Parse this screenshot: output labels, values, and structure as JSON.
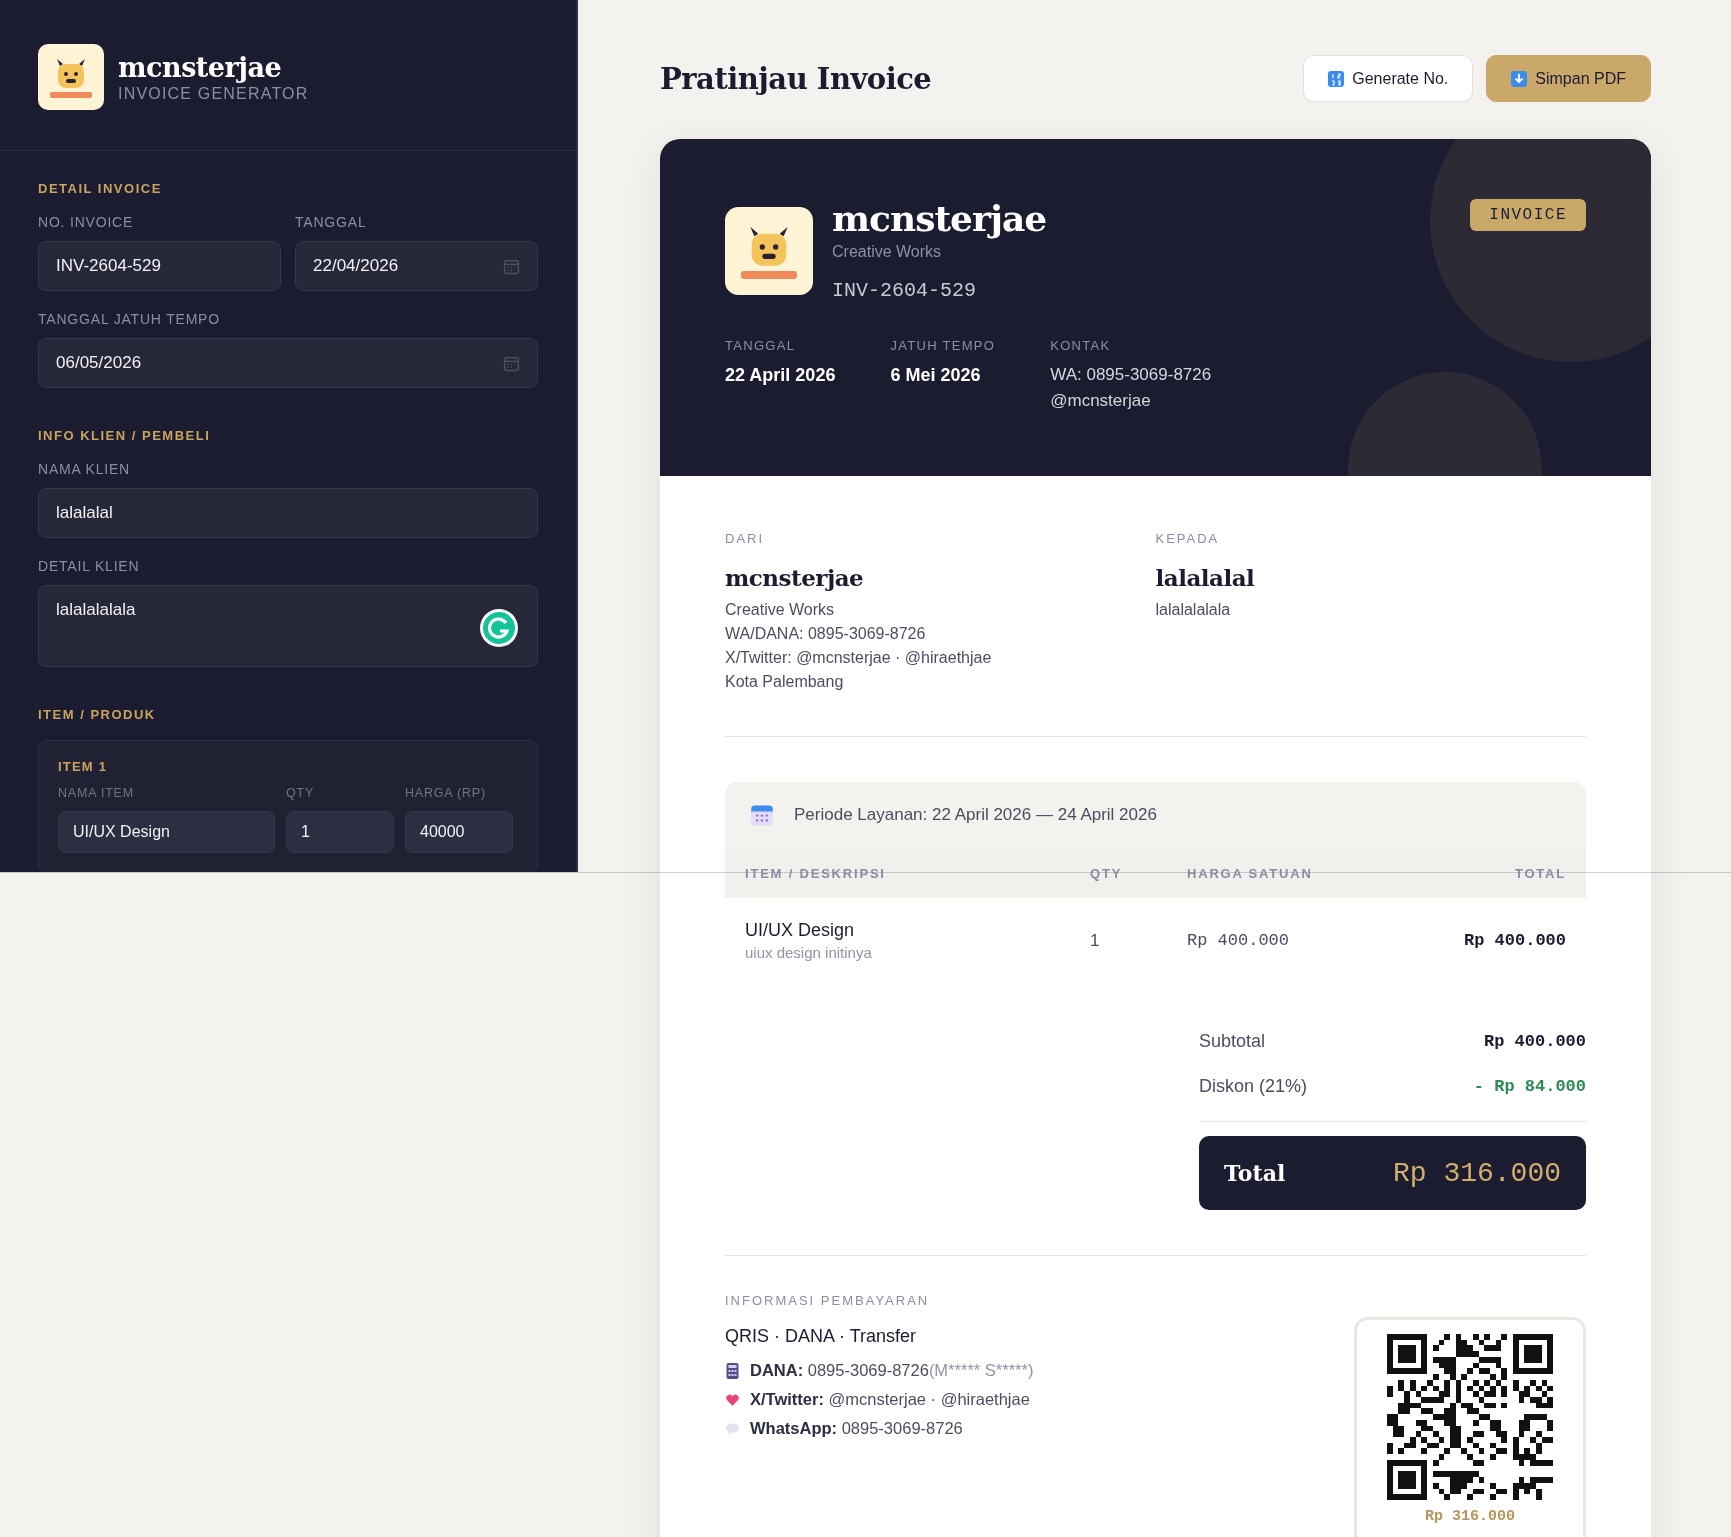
{
  "sidebar": {
    "brand": {
      "name": "mcnsterjae",
      "subtitle": "INVOICE GENERATOR"
    },
    "sections": [
      {
        "heading": "DETAIL INVOICE",
        "rows": [
          [
            {
              "label": "NO. INVOICE",
              "value": "INV-2604-529",
              "kind": "text"
            },
            {
              "label": "TANGGAL",
              "value": "22/04/2026",
              "kind": "date"
            }
          ],
          [
            {
              "label": "TANGGAL JATUH TEMPO",
              "value": "06/05/2026",
              "kind": "date"
            }
          ]
        ]
      },
      {
        "heading": "INFO KLIEN / PEMBELI",
        "rows": [
          [
            {
              "label": "NAMA KLIEN",
              "value": "lalalalal",
              "kind": "text"
            }
          ],
          [
            {
              "label": "DETAIL KLIEN",
              "value": "lalalalalala",
              "kind": "textarea"
            }
          ]
        ]
      }
    ],
    "items_section": {
      "heading": "ITEM / PRODUK",
      "items": [
        {
          "title": "ITEM 1",
          "fields": [
            {
              "label": "NAMA ITEM",
              "value": "UI/UX Design"
            },
            {
              "label": "QTY",
              "value": "1"
            },
            {
              "label": "HARGA (RP)",
              "value": "40000"
            }
          ]
        }
      ]
    }
  },
  "main": {
    "title": "Pratinjau Invoice",
    "buttons": [
      {
        "label": "Generate No.",
        "kind": "secondary"
      },
      {
        "label": "Simpan PDF",
        "kind": "primary"
      }
    ],
    "invoice": {
      "header": {
        "name": "mcnsterjae",
        "tagline": "Creative Works",
        "number": "INV-2604-529",
        "badge": "INVOICE",
        "meta": [
          {
            "label": "TANGGAL",
            "lines": [
              "22 April 2026"
            ],
            "kind": "strong"
          },
          {
            "label": "JATUH TEMPO",
            "lines": [
              "6 Mei 2026"
            ],
            "kind": "strong"
          },
          {
            "label": "KONTAK",
            "lines": [
              "WA: 0895-3069-8726",
              "@mcnsterjae"
            ],
            "kind": "plain"
          }
        ]
      },
      "parties": [
        {
          "label": "DARI",
          "name": "mcnsterjae",
          "lines": [
            "Creative Works",
            "WA/DANA: 0895-3069-8726",
            "X/Twitter: @mcnsterjae · @hiraethjae",
            "Kota Palembang"
          ]
        },
        {
          "label": "KEPADA",
          "name": "lalalalal",
          "lines": [
            "lalalalalala"
          ]
        }
      ],
      "period": "Periode Layanan: 22 April 2026 — 24 April 2026",
      "table": {
        "columns": [
          "ITEM / DESKRIPSI",
          "QTY",
          "HARGA SATUAN",
          "TOTAL"
        ],
        "rows": [
          {
            "name": "UI/UX Design",
            "description": "uiux design initinya",
            "qty": "1",
            "price": "Rp 400.000",
            "total": "Rp 400.000"
          }
        ]
      },
      "summary": [
        {
          "label": "Subtotal",
          "value": "Rp 400.000",
          "kind": "normal"
        },
        {
          "label": "Diskon (21%)",
          "value": "- Rp 84.000",
          "kind": "discount"
        }
      ],
      "total": {
        "label": "Total",
        "value": "Rp 316.000"
      },
      "payment": {
        "heading": "INFORMASI PEMBAYARAN",
        "methods": "QRIS · DANA · Transfer",
        "lines": [
          {
            "kind": "wallet",
            "label": "DANA:",
            "value": "0895-3069-8726",
            "note": "(M***** S*****)"
          },
          {
            "kind": "social",
            "label": "X/Twitter:",
            "value": "@mcnsterjae · @hiraethjae"
          },
          {
            "kind": "chat",
            "label": "WhatsApp:",
            "value": "0895-3069-8726"
          }
        ],
        "qr_caption": "Rp 316.000"
      }
    }
  }
}
